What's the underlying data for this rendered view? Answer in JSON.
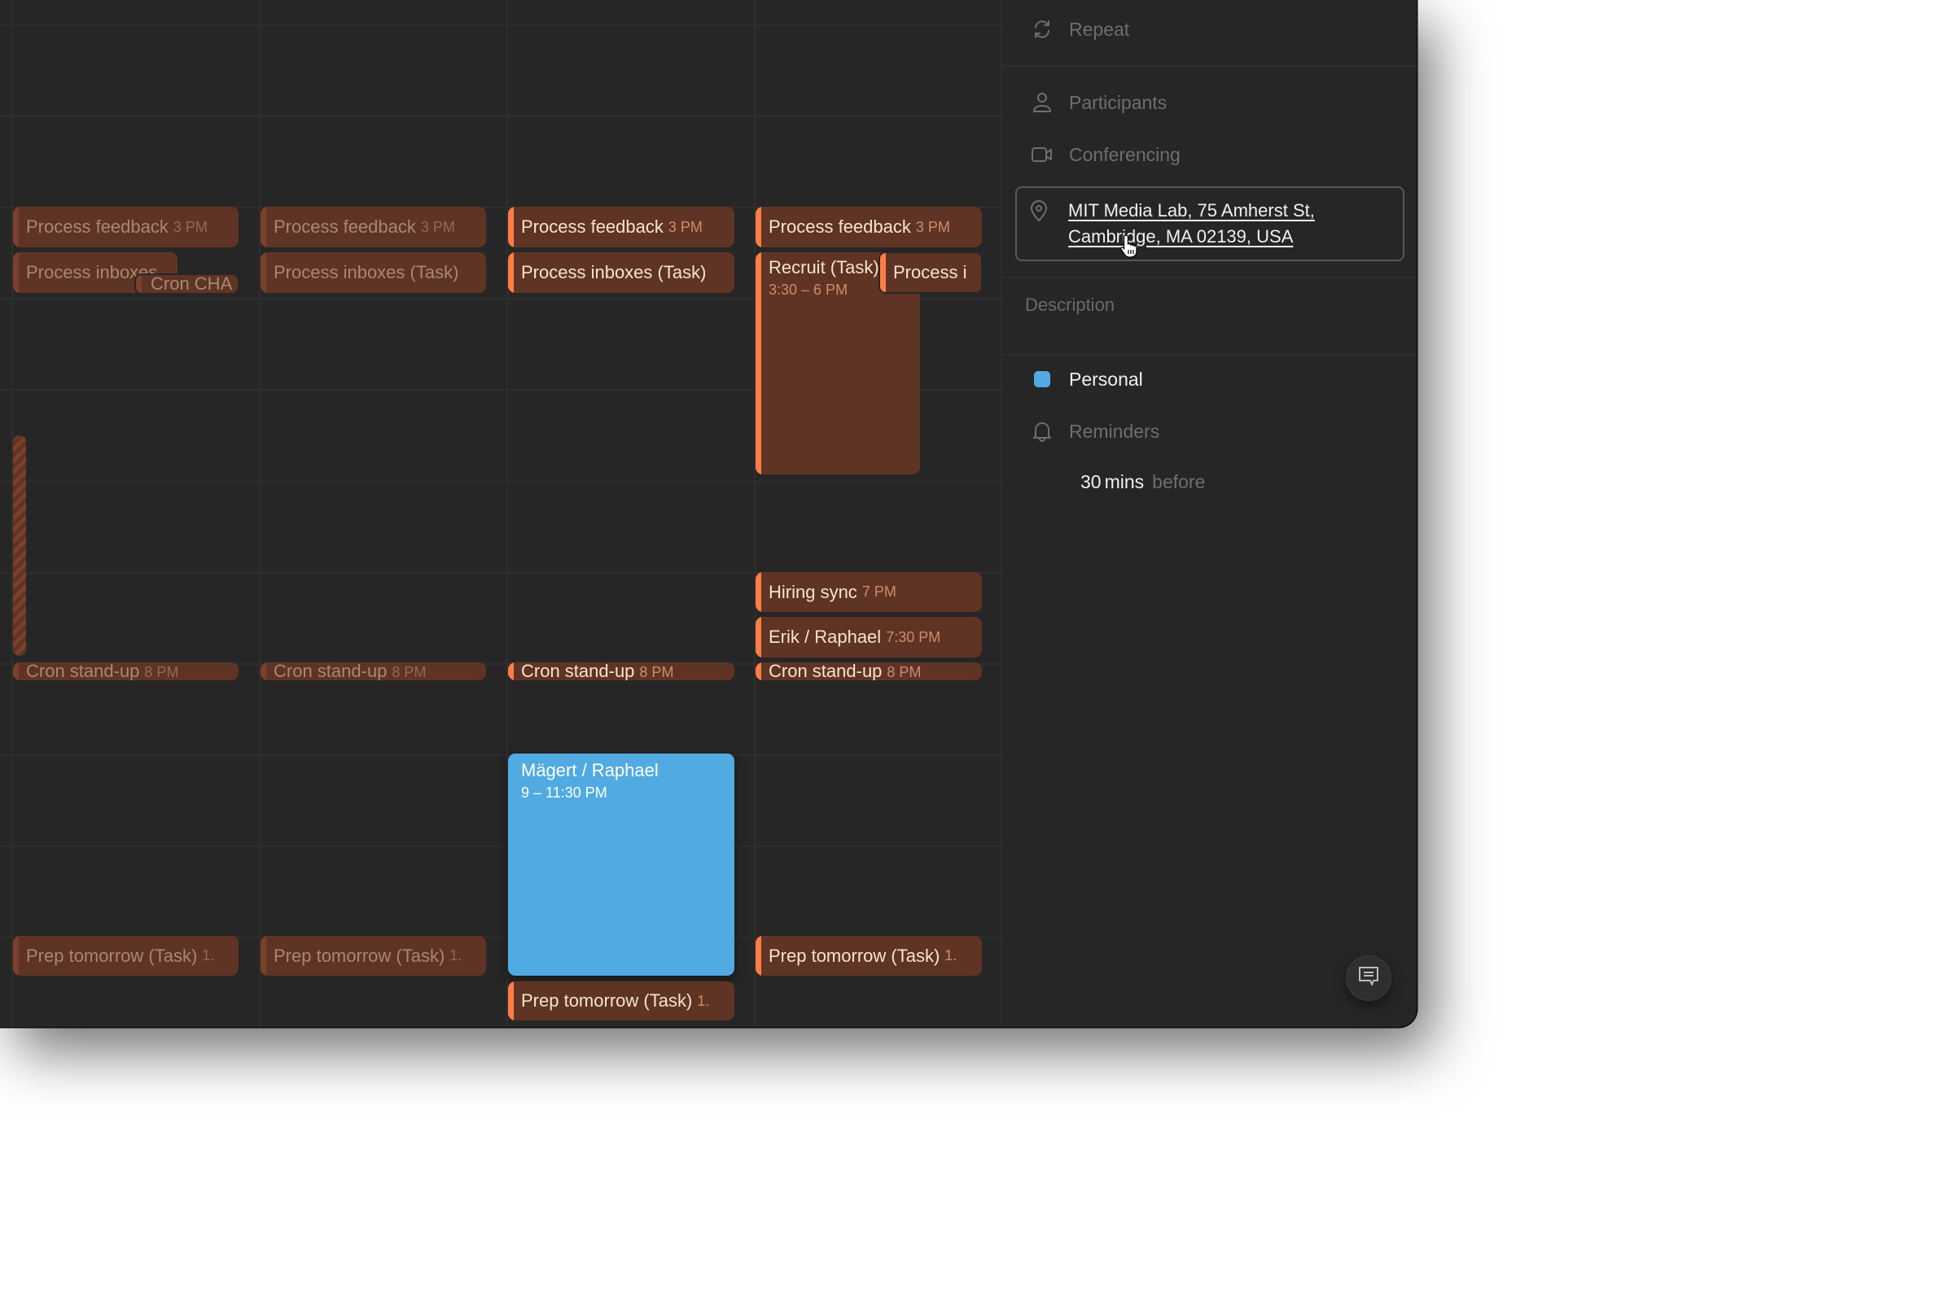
{
  "calendar": {
    "columns": [
      {
        "events": [
          {
            "title": "Process feedback",
            "time": "3 PM",
            "state": "past"
          },
          {
            "title": "Process inboxes",
            "state": "past"
          },
          {
            "title": "Cron CHA",
            "state": "past"
          },
          {
            "title": "Cron stand-up",
            "time": "8 PM",
            "state": "past"
          },
          {
            "title": "Prep tomorrow (Task)",
            "time": "1.",
            "state": "past"
          }
        ]
      },
      {
        "events": [
          {
            "title": "Process feedback",
            "time": "3 PM",
            "state": "past"
          },
          {
            "title": "Process inboxes (Task)",
            "state": "past"
          },
          {
            "title": "Cron stand-up",
            "time": "8 PM",
            "state": "past"
          },
          {
            "title": "Prep tomorrow (Task)",
            "time": "1.",
            "state": "past"
          }
        ]
      },
      {
        "events": [
          {
            "title": "Process feedback",
            "time": "3 PM",
            "state": "upcoming"
          },
          {
            "title": "Process inboxes (Task)",
            "state": "upcoming"
          },
          {
            "title": "Cron stand-up",
            "time": "8 PM",
            "state": "upcoming"
          },
          {
            "title": "Mägert / Raphael",
            "time": "9 – 11:30 PM",
            "state": "selected",
            "calendar": "Personal"
          },
          {
            "title": "Prep tomorrow (Task)",
            "time": "1.",
            "state": "upcoming"
          }
        ]
      },
      {
        "events": [
          {
            "title": "Process feedback",
            "time": "3 PM",
            "state": "upcoming"
          },
          {
            "title": "Recruit (Task)",
            "time": "3:30 – 6 PM",
            "state": "upcoming"
          },
          {
            "title": "Process i",
            "state": "upcoming"
          },
          {
            "title": "Hiring sync",
            "time": "7 PM",
            "state": "upcoming"
          },
          {
            "title": "Erik / Raphael",
            "time": "7:30 PM",
            "state": "upcoming"
          },
          {
            "title": "Cron stand-up",
            "time": "8 PM",
            "state": "upcoming"
          },
          {
            "title": "Prep tomorrow (Task)",
            "time": "1.",
            "state": "upcoming"
          }
        ]
      }
    ]
  },
  "sidebar": {
    "repeat_label": "Repeat",
    "participants_label": "Participants",
    "conferencing_label": "Conferencing",
    "location_line1": "MIT Media Lab, 75 Amherst St,",
    "location_line2": "Cambridge, MA 02139, USA",
    "description_placeholder": "Description",
    "calendar_name": "Personal",
    "calendar_color": "#52aae2",
    "reminders_label": "Reminders",
    "reminder_amount": "30",
    "reminder_unit": "mins",
    "reminder_suffix": "before"
  },
  "colors": {
    "event_bg": "#5f3424",
    "event_accent": "#ff7d45",
    "selected_event": "#52aae2",
    "window_bg": "#262626"
  },
  "icons": {
    "repeat": "repeat-icon",
    "participants": "person-icon",
    "conferencing": "video-camera-icon",
    "location": "map-pin-icon",
    "reminders": "bell-icon",
    "feedback": "chat-bubble-icon"
  }
}
